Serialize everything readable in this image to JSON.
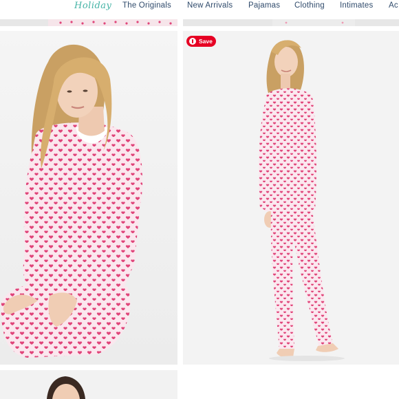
{
  "nav": {
    "logo": "Holiday",
    "items": [
      "The Originals",
      "New Arrivals",
      "Pajamas",
      "Clothing",
      "Intimates",
      "Ac"
    ]
  },
  "pin": {
    "label": "Save"
  },
  "colors": {
    "heart": "#e0457a",
    "pajama": "#fbe7ee",
    "nav_text": "#2f4a6b",
    "logo": "#43b3a5",
    "pin_red": "#e60023"
  }
}
